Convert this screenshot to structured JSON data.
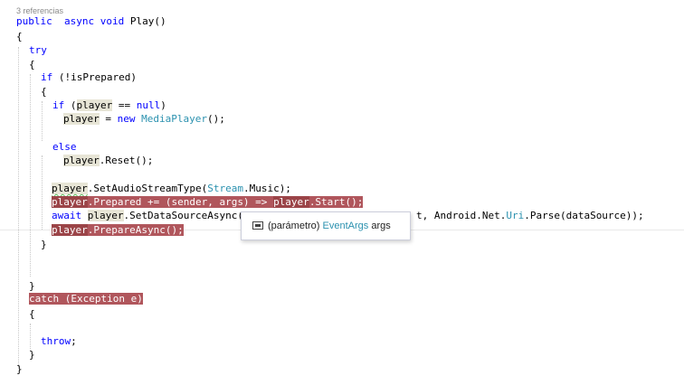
{
  "editor": {
    "codelens": "3 referencias",
    "lines": {
      "l1": {
        "kw1": "public",
        "kw2": "async",
        "kw3": "void",
        "rest": " Play()"
      },
      "l2": {
        "text": "{"
      },
      "l3": {
        "kw": "try"
      },
      "l4": {
        "text": "{"
      },
      "l5": {
        "kw": "if",
        "rest": " (!isPrepared)"
      },
      "l6": {
        "text": "{"
      },
      "l7": {
        "kw": "if",
        "open": " (",
        "ref": "player",
        "mid": " == ",
        "kw2": "null",
        "close": ")"
      },
      "l8": {
        "ref": "player",
        "mid": " = ",
        "kw": "new",
        "sp": " ",
        "type": "MediaPlayer",
        "close": "();"
      },
      "l10": {
        "kw": "else"
      },
      "l11": {
        "ref": "player",
        "rest": ".Reset();"
      },
      "l13": {
        "ref": "player",
        "a": ".SetAudioStreamType(",
        "type": "Stream",
        "b": ".Music);"
      },
      "l14": {
        "p1": "player",
        "p2": ".Prepared += (sender, args) => ",
        "p3": "player",
        "p4": ".Start();"
      },
      "l15": {
        "kw": "await",
        "sp": " ",
        "ref": "player",
        "a": ".SetDataSourceAsync(A",
        "b": "t, Android.Net.",
        "type": "Uri",
        "c": ".Parse(dataSource));"
      },
      "l16": {
        "p1": "player",
        "p2": ".PrepareAsync();"
      },
      "l17": {
        "text": "}"
      },
      "l20": {
        "text": "}"
      },
      "l21": {
        "text": "catch (Exception e)"
      },
      "l22": {
        "text": "{"
      },
      "l24": {
        "kw": "throw",
        "rest": ";"
      },
      "l25": {
        "text": "}"
      },
      "l26": {
        "text": "}"
      }
    }
  },
  "tooltip": {
    "icon": "parameter-icon",
    "prefix": "(parámetro) ",
    "type": "EventArgs",
    "name": " args"
  },
  "colors": {
    "keyword": "#0000ff",
    "type": "#2b91af",
    "reference_highlight": "#e7e5d6",
    "breakpoint_highlight": "#b0565c"
  }
}
